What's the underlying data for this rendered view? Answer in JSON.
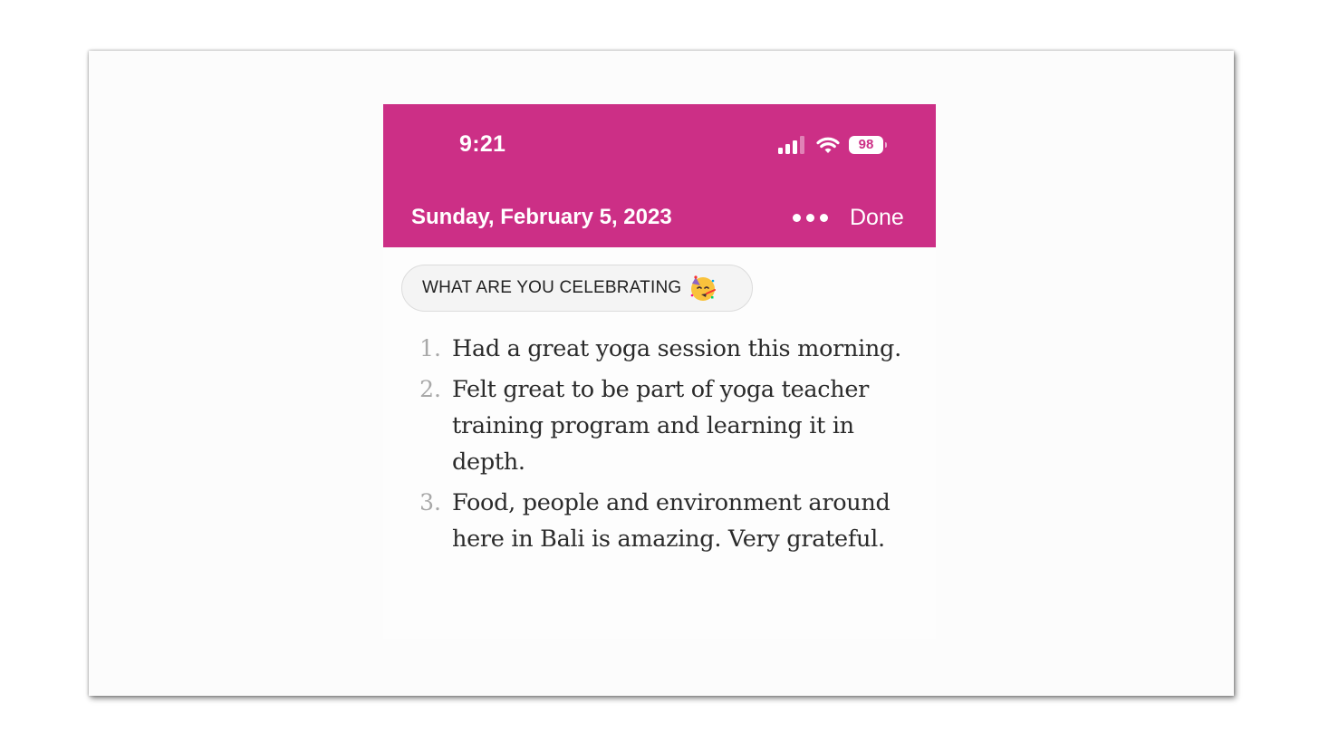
{
  "status_bar": {
    "time": "9:21",
    "battery": "98"
  },
  "colors": {
    "header_bg": "#cc2f86",
    "page_bg": "#fdfdfd",
    "number_color": "#a8a8a8",
    "text_color": "#2b2b2b"
  },
  "icons": {
    "signal": "signal-icon",
    "wifi": "wifi-icon",
    "battery": "battery-icon",
    "more": "more-icon",
    "emoji": "partying-face-icon"
  },
  "header": {
    "date": "Sunday, February 5, 2023",
    "done_label": "Done"
  },
  "prompt": {
    "label": "WHAT ARE YOU CELEBRATING"
  },
  "entries": [
    {
      "number": "1.",
      "text": "Had a great yoga session this morning."
    },
    {
      "number": "2.",
      "text": "Felt great to be part of yoga teacher training program and learning it in depth."
    },
    {
      "number": "3.",
      "text": "Food, people and environment around here in Bali is amazing. Very grateful."
    }
  ]
}
